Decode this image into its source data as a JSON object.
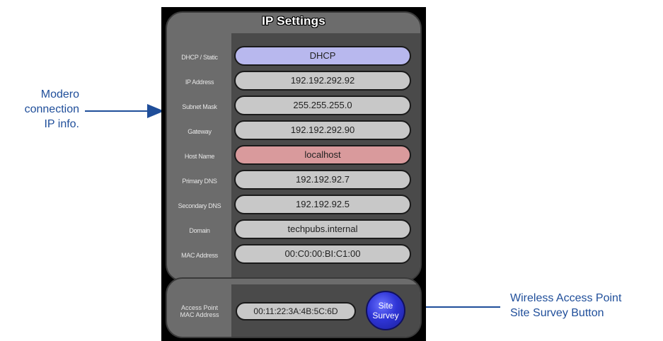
{
  "panel": {
    "title": "IP Settings",
    "rows": [
      {
        "label": "DHCP / Static",
        "value": "DHCP"
      },
      {
        "label": "IP Address",
        "value": "192.192.292.92"
      },
      {
        "label": "Subnet Mask",
        "value": "255.255.255.0"
      },
      {
        "label": "Gateway",
        "value": "192.192.292.90"
      },
      {
        "label": "Host Name",
        "value": "localhost"
      },
      {
        "label": "Primary DNS",
        "value": "192.192.92.7"
      },
      {
        "label": "Secondary DNS",
        "value": "192.192.92.5"
      },
      {
        "label": "Domain",
        "value": "techpubs.internal"
      },
      {
        "label": "MAC Address",
        "value": "00:C0:00:BI:C1:00"
      }
    ]
  },
  "access_point": {
    "label_line1": "Access Point",
    "label_line2": "MAC Address",
    "value": "00:11:22:3A:4B:5C:6D",
    "button_line1": "Site",
    "button_line2": "Survey"
  },
  "callouts": {
    "left": [
      "Modero",
      "connection",
      "IP info."
    ],
    "right": [
      "Wireless Access Point",
      "Site Survey Button"
    ]
  },
  "colors": {
    "callout": "#1f4e9a",
    "dhcp_field": "#b8b8ee",
    "host_field": "#d99a9c",
    "default_field": "#c8c8c8",
    "site_button": "#2f35d6"
  }
}
